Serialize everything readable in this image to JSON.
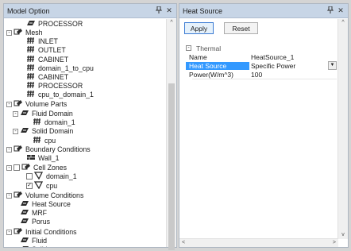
{
  "left_panel": {
    "title": "Model Option",
    "pin_icon": "pin-icon",
    "close_icon": "close-icon",
    "tree": [
      {
        "label": "PROCESSOR",
        "icon": "part-icon"
      },
      {
        "label": "Mesh",
        "icon": "folder-icon",
        "expander": "-"
      },
      {
        "label": "INLET",
        "icon": "mesh-icon"
      },
      {
        "label": "OUTLET",
        "icon": "mesh-icon"
      },
      {
        "label": "CABINET",
        "icon": "mesh-icon"
      },
      {
        "label": "domain_1_to_cpu",
        "icon": "mesh-icon"
      },
      {
        "label": "CABINET",
        "icon": "mesh-icon"
      },
      {
        "label": "PROCESSOR",
        "icon": "mesh-icon"
      },
      {
        "label": "cpu_to_domain_1",
        "icon": "mesh-icon"
      },
      {
        "label": "Volume Parts",
        "icon": "folder-icon",
        "expander": "-"
      },
      {
        "label": "Fluid Domain",
        "icon": "part-icon",
        "expander": "-"
      },
      {
        "label": "domain_1",
        "icon": "mesh-icon"
      },
      {
        "label": "Solid Domain",
        "icon": "part-icon",
        "expander": "-"
      },
      {
        "label": "cpu",
        "icon": "mesh-icon"
      },
      {
        "label": "Boundary Conditions",
        "icon": "folder-icon",
        "expander": "-"
      },
      {
        "label": "Wall_1",
        "icon": "wall-icon"
      },
      {
        "label": "Cell Zones",
        "icon": "folder-icon",
        "expander": "-",
        "checkbox": false
      },
      {
        "label": "domain_1",
        "icon": "zone-icon",
        "checkbox": false
      },
      {
        "label": "cpu",
        "icon": "zone-icon",
        "checkbox": true
      },
      {
        "label": "Volume Conditions",
        "icon": "folder-icon",
        "expander": "-"
      },
      {
        "label": "Heat Source",
        "icon": "part-icon"
      },
      {
        "label": "MRF",
        "icon": "part-icon"
      },
      {
        "label": "Porus",
        "icon": "part-icon"
      },
      {
        "label": "Initial Conditions",
        "icon": "folder-icon",
        "expander": "-"
      },
      {
        "label": "Fluid",
        "icon": "part-icon"
      },
      {
        "label": "Solid",
        "icon": "part-icon"
      }
    ]
  },
  "right_panel": {
    "title": "Heat Source",
    "pin_icon": "pin-icon",
    "close_icon": "close-icon",
    "apply_label": "Apply",
    "reset_label": "Reset",
    "group_label": "Thermal",
    "group_expander": "-",
    "properties": [
      {
        "key": "Name",
        "value": "HeatSource_1"
      },
      {
        "key": "Heat Source",
        "value": "Specific Power",
        "selected": true,
        "dropdown": true
      },
      {
        "key": "Power(W/m^3)",
        "value": "100"
      }
    ]
  },
  "colors": {
    "titlebar": "#c7d5e6",
    "selection": "#3399ff",
    "accent": "#3b7bd3"
  }
}
